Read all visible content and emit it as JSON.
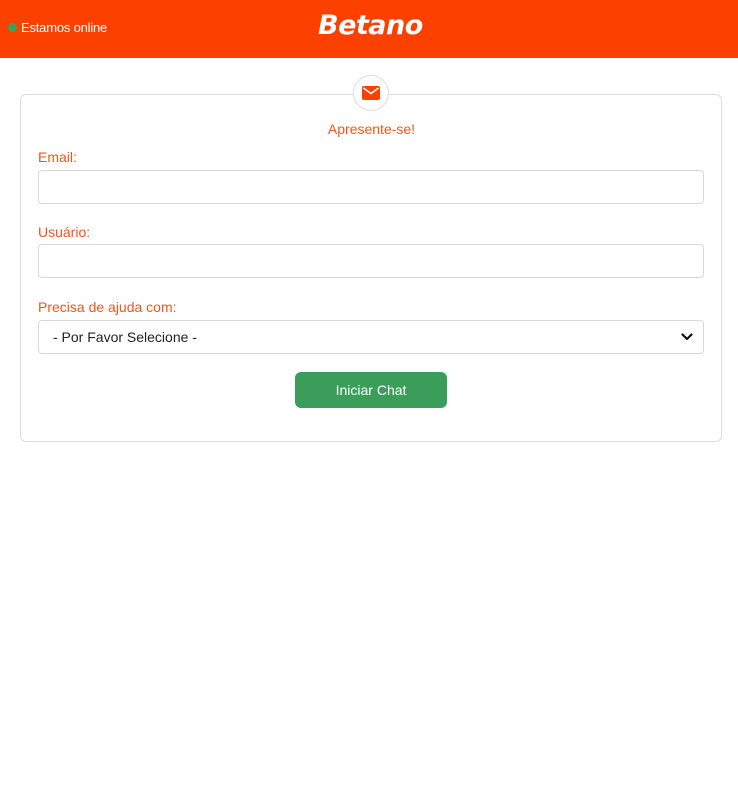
{
  "header": {
    "status_text": "Estamos online",
    "status_color": "#3ca15a",
    "brand": "Betano",
    "background_color": "#fc4000"
  },
  "form": {
    "icon": "envelope-icon",
    "title": "Apresente-se!",
    "email_label": "Email:",
    "email_value": "",
    "username_label": "Usuário:",
    "username_value": "",
    "help_label": "Precisa de ajuda com:",
    "help_selected": "- Por Favor Selecione -",
    "submit_label": "Iniciar Chat",
    "accent_color": "#f2551a",
    "submit_color": "#3a9e5a"
  }
}
